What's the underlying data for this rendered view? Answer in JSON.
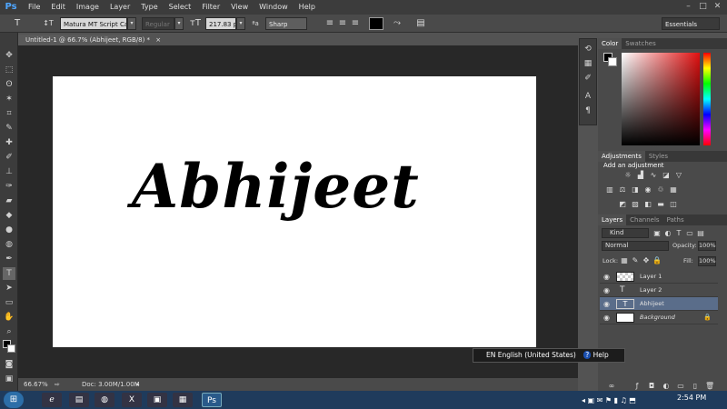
{
  "app": {
    "logo": "Ps"
  },
  "menu": [
    "File",
    "Edit",
    "Image",
    "Layer",
    "Type",
    "Select",
    "Filter",
    "View",
    "Window",
    "Help"
  ],
  "window_controls": [
    "–",
    "□",
    "✕"
  ],
  "options_bar": {
    "font_family": "Matura MT Script Capit...",
    "font_style": "Regular",
    "font_size": "217.83 pt",
    "antialias_label": "ªa",
    "antialias": "Sharp",
    "color_swatch": "#000000",
    "workspace": "Essentials"
  },
  "document": {
    "tab_title": "Untitled-1 @ 66.7% (Abhijeet, RGB/8) *",
    "text_layer_content": "Abhijeet"
  },
  "status": {
    "zoom": "66.67%",
    "doc_info": "Doc: 3.00M/1.00M"
  },
  "panels": {
    "color_tabs": [
      "Color",
      "Swatches"
    ],
    "adjust_tabs": [
      "Adjustments",
      "Styles"
    ],
    "adjust_title": "Add an adjustment",
    "layers_tabs": [
      "Layers",
      "Channels",
      "Paths"
    ],
    "kind": "Kind",
    "blend_mode": "Normal",
    "opacity_label": "Opacity:",
    "opacity": "100%",
    "lock_label": "Lock:",
    "fill_label": "Fill:",
    "fill": "100%",
    "layers": [
      {
        "name": "Layer 1"
      },
      {
        "name": "Layer 2"
      },
      {
        "name": "Abhijeet"
      },
      {
        "name": "Background"
      }
    ]
  },
  "language_bar": {
    "text": "EN English (United States)",
    "help": "Help"
  },
  "taskbar": {
    "time": "2:54 PM"
  },
  "colors": {
    "accent": "#4fa6ff",
    "selected_layer": "#5a6d8a",
    "taskbar": "#1f3b5c"
  }
}
